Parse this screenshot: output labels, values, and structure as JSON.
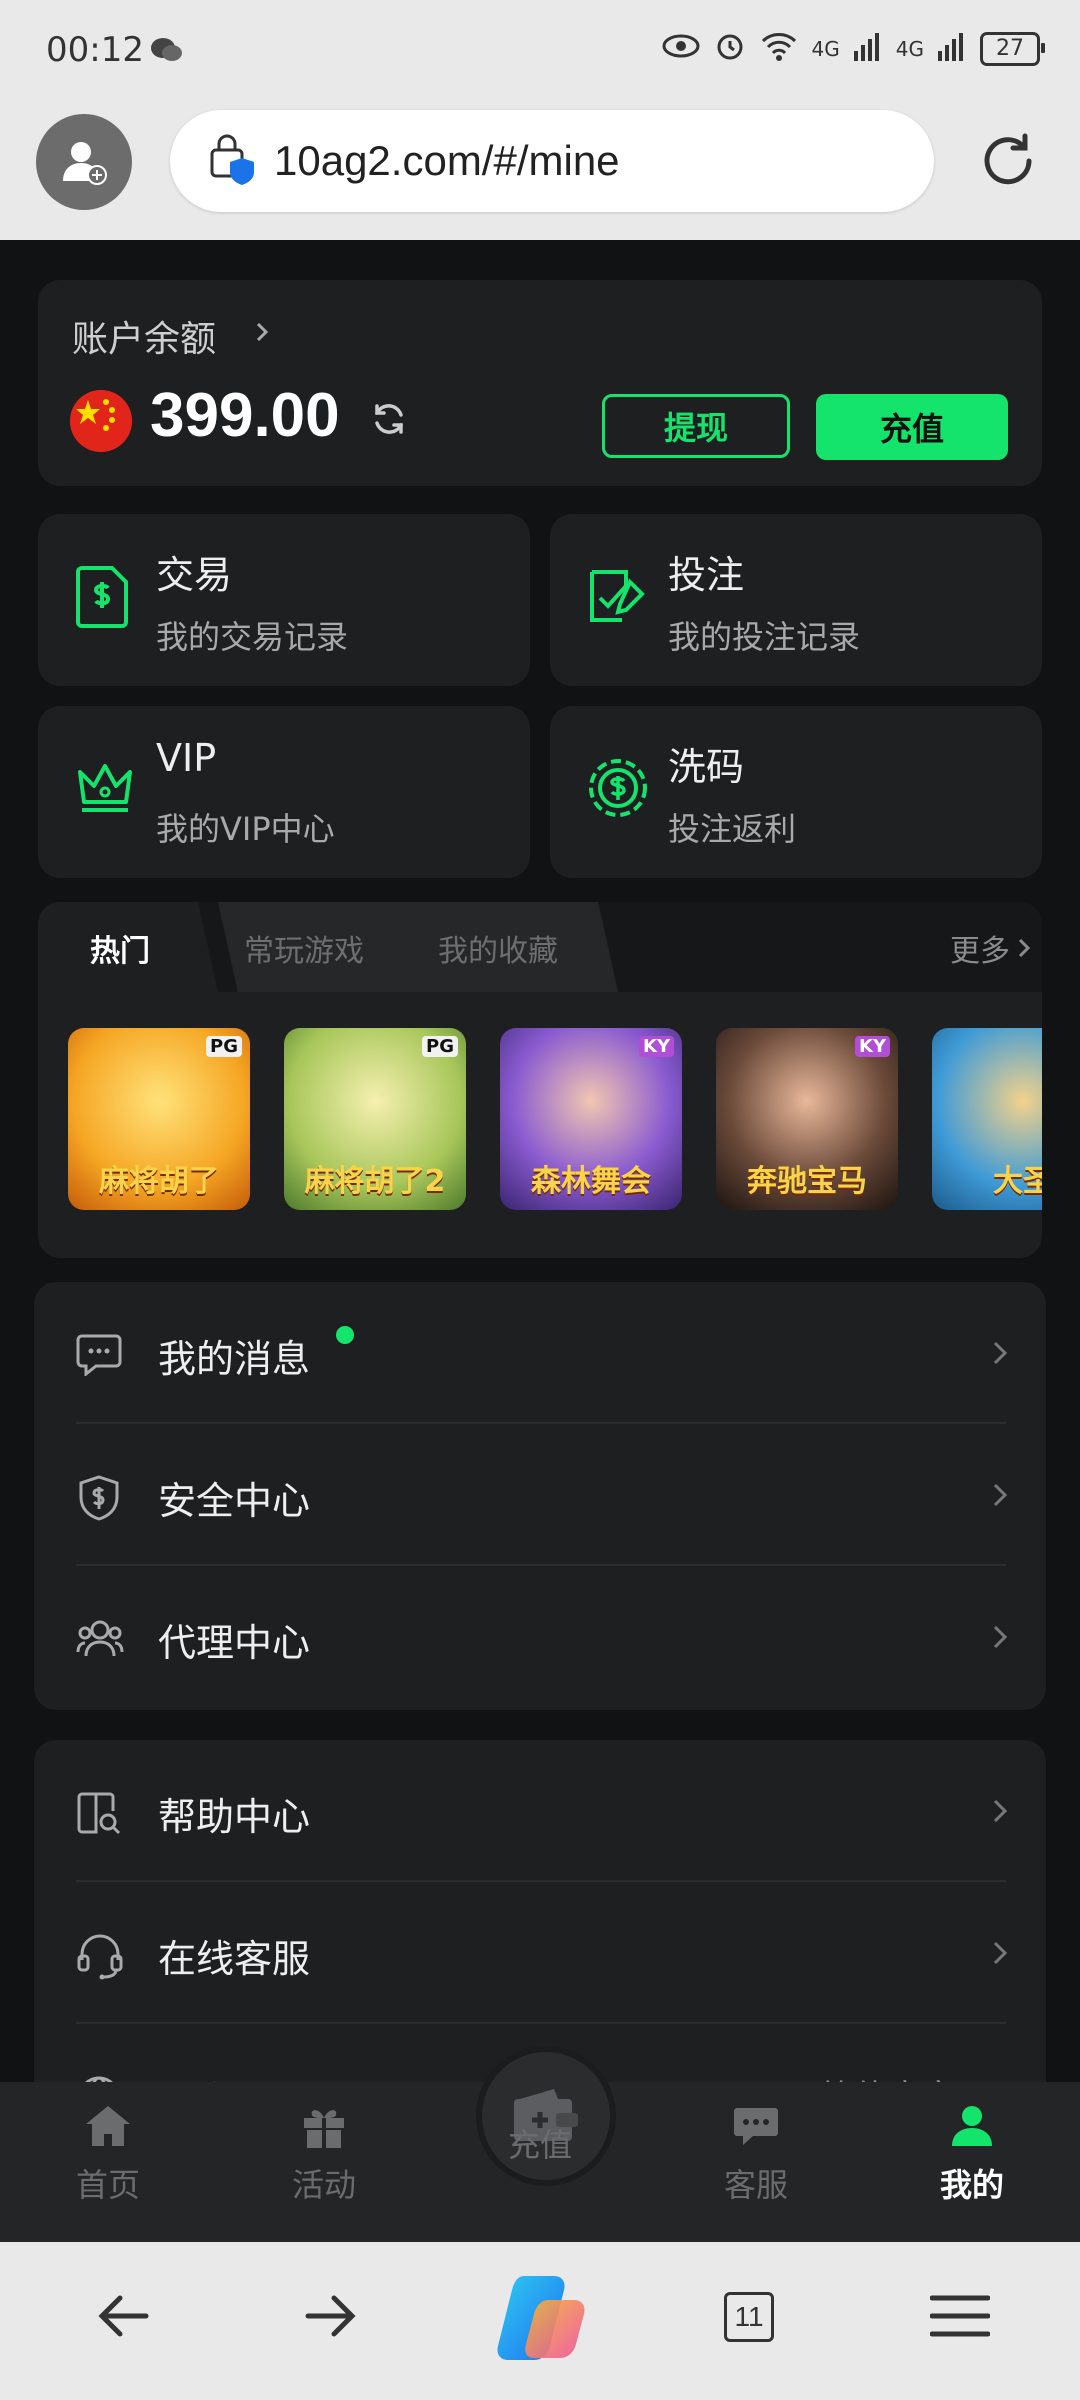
{
  "status_bar": {
    "time": "00:12",
    "battery": "27",
    "signal_1": "4G",
    "signal_2": "4G"
  },
  "browser": {
    "url": "10ag2.com/#/mine",
    "tab_count": "11"
  },
  "balance": {
    "label": "账户余额",
    "amount": "399.00",
    "withdraw": "提现",
    "deposit": "充值"
  },
  "tiles": {
    "trade": {
      "title": "交易",
      "sub": "我的交易记录"
    },
    "bet": {
      "title": "投注",
      "sub": "我的投注记录"
    },
    "vip": {
      "title": "VIP",
      "sub": "我的VIP中心"
    },
    "rebate": {
      "title": "洗码",
      "sub": "投注返利"
    }
  },
  "games": {
    "tabs": [
      "热门",
      "常玩游戏",
      "我的收藏"
    ],
    "more": "更多",
    "items": [
      {
        "title": "麻将胡了",
        "badge": "PG",
        "color": "#f5a623"
      },
      {
        "title": "麻将胡了2",
        "badge": "PG",
        "color": "#a8c65a"
      },
      {
        "title": "森林舞会",
        "badge": "KY",
        "color": "#5b3fa0"
      },
      {
        "title": "奔驰宝马",
        "badge": "KY",
        "color": "#3b2a22"
      },
      {
        "title": "大圣",
        "badge": "",
        "color": "#3f9bd6"
      }
    ]
  },
  "menu_1": [
    {
      "label": "我的消息",
      "icon": "message-icon"
    },
    {
      "label": "安全中心",
      "icon": "shield-icon"
    },
    {
      "label": "代理中心",
      "icon": "users-icon"
    }
  ],
  "menu_2": [
    {
      "label": "帮助中心",
      "icon": "help-icon"
    },
    {
      "label": "在线客服",
      "icon": "headset-icon"
    },
    {
      "label": "语言",
      "value": "简体中文",
      "icon": "globe-icon"
    }
  ],
  "bottom_nav": {
    "home": "首页",
    "activity": "活动",
    "deposit": "充值",
    "service": "客服",
    "mine": "我的"
  },
  "colors": {
    "accent": "#14e46b",
    "card": "#1e1f21",
    "background": "#111213"
  }
}
